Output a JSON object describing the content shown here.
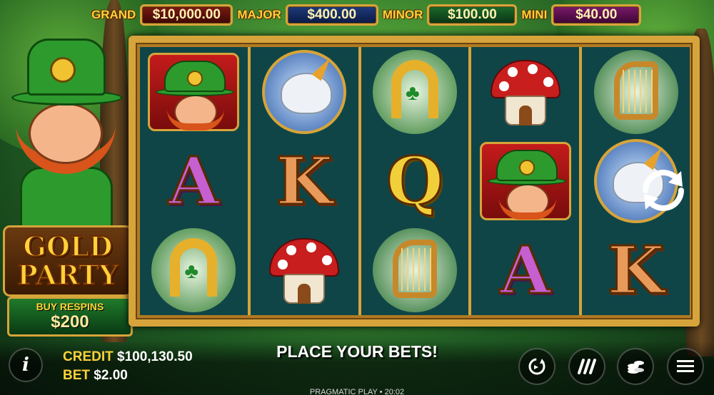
{
  "jackpots": [
    {
      "label": "GRAND",
      "value": "$10,000.00"
    },
    {
      "label": "MAJOR",
      "value": "$400.00"
    },
    {
      "label": "MINOR",
      "value": "$100.00"
    },
    {
      "label": "MINI",
      "value": "$40.00"
    }
  ],
  "logo": {
    "line1": "GOLD",
    "line2": "PARTY"
  },
  "buy_respins": {
    "label": "BUY RESPINS",
    "price": "$200"
  },
  "reels": [
    [
      "leprechaun",
      "A",
      "horseshoe"
    ],
    [
      "unicorn",
      "K",
      "mushroom"
    ],
    [
      "horseshoe",
      "Q",
      "harp"
    ],
    [
      "mushroom",
      "leprechaun",
      "A"
    ],
    [
      "harp",
      "unicorn",
      "K"
    ]
  ],
  "bottom": {
    "info_label": "i",
    "credit_label": "CREDIT",
    "credit_value": "$100,130.50",
    "bet_label": "BET",
    "bet_value": "$2.00",
    "message": "PLACE YOUR BETS!",
    "footer": "PRAGMATIC PLAY • 20:02"
  },
  "controls": [
    "autoplay-icon",
    "turbo-icon",
    "bet-coins-icon",
    "menu-icon"
  ],
  "colors": {
    "gold": "#d6a43a",
    "reel_bg": "#0f4547",
    "label_yellow": "#ffd23a"
  }
}
